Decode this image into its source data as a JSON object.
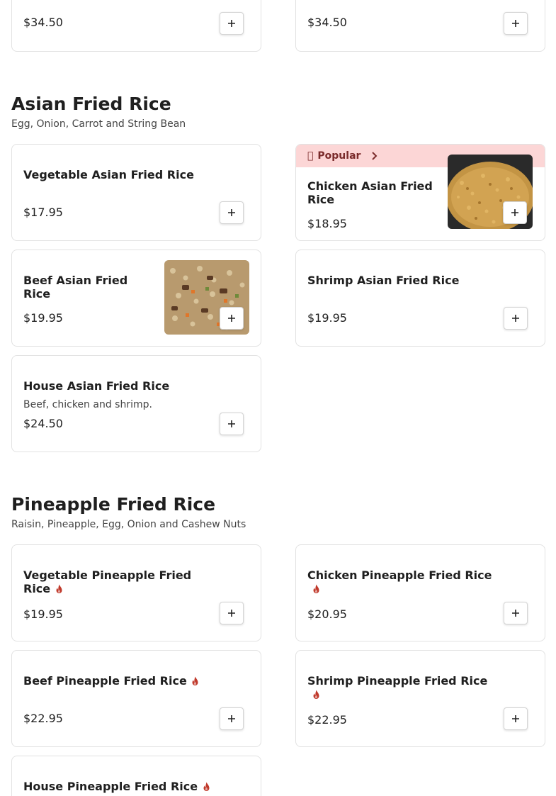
{
  "top_cards": [
    {
      "price": "$34.50"
    },
    {
      "price": "$34.50"
    }
  ],
  "sections": [
    {
      "title": "Asian Fried Rice",
      "description": "Egg, Onion, Carrot and String Bean",
      "items": [
        {
          "name": "Vegetable Asian Fried Rice",
          "price": "$17.95"
        },
        {
          "name": "Chicken Asian Fried Rice",
          "price": "$18.95",
          "badge": "Popular",
          "badge_glyph": "",
          "image": "chicken-fried-rice-photo"
        },
        {
          "name": "Beef Asian Fried Rice",
          "price": "$19.95",
          "image": "beef-fried-rice-photo"
        },
        {
          "name": "Shrimp Asian Fried Rice",
          "price": "$19.95"
        },
        {
          "name": "House Asian Fried Rice",
          "description": "Beef, chicken and shrimp.",
          "price": "$24.50"
        }
      ]
    },
    {
      "title": "Pineapple Fried Rice",
      "description": "Raisin, Pineapple, Egg, Onion and Cashew Nuts",
      "items": [
        {
          "name": "Vegetable Pineapple Fried Rice",
          "price": "$19.95",
          "spicy": true
        },
        {
          "name": "Chicken Pineapple Fried Rice",
          "price": "$20.95",
          "spicy": true
        },
        {
          "name": "Beef Pineapple Fried Rice",
          "price": "$22.95",
          "spicy": true
        },
        {
          "name": "Shrimp Pineapple Fried Rice",
          "price": "$22.95",
          "spicy": true
        },
        {
          "name": "House Pineapple Fried Rice",
          "spicy": true
        }
      ]
    }
  ],
  "colors": {
    "spicy_icon": "#c0392b",
    "popular_banner": "#fcd6d6",
    "popular_text": "#7a2a2a"
  },
  "icons": {
    "add": "plus-icon",
    "spicy": "flame-icon",
    "popular_arrow": "chevron-right-icon"
  }
}
